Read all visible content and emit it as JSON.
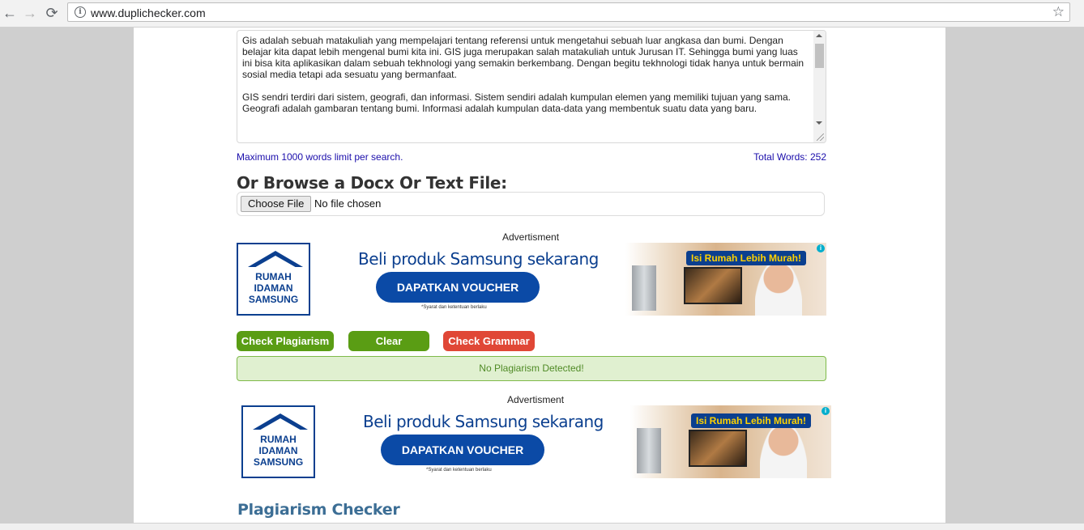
{
  "browser": {
    "url": "www.duplichecker.com",
    "back_icon": "←",
    "forward_icon": "→",
    "reload_icon": "⟳",
    "info_icon": "i",
    "star_icon": "☆"
  },
  "editor": {
    "text": "Gis adalah sebuah matakuliah yang mempelajari tentang referensi untuk mengetahui sebuah luar angkasa dan bumi. Dengan belajar kita dapat lebih mengenal bumi kita ini. GIS juga merupakan salah matakuliah untuk Jurusan IT. Sehingga bumi yang luas ini bisa kita aplikasikan dalam sebuah tekhnologi yang semakin berkembang. Dengan begitu tekhnologi tidak hanya untuk bermain sosial media tetapi ada sesuatu yang bermanfaat.\n\nGIS sendri terdiri dari sistem, geografi, dan informasi. Sistem sendiri adalah kumpulan elemen yang memiliki tujuan yang sama. Geografi adalah gambaran tentang bumi. Informasi adalah kumpulan data-data yang membentuk suatu data yang baru.",
    "limit_text": "Maximum 1000 words limit per search.",
    "total_words": "Total Words: 252"
  },
  "upload": {
    "heading": "Or Browse a Docx Or Text File:",
    "button_label": "Choose File",
    "status": "No file chosen"
  },
  "ads": [
    {
      "label": "Advertisment",
      "logo_text": "RUMAH\nIDAMAN\nSAMSUNG",
      "headline": "Beli produk Samsung sekarang",
      "cta": "DAPATKAN VOUCHER",
      "fine_print": "*Syarat dan ketentuan berlaku",
      "tag": "Isi Rumah Lebih Murah!",
      "info_icon": "i"
    },
    {
      "label": "Advertisment",
      "logo_text": "RUMAH\nIDAMAN\nSAMSUNG",
      "headline": "Beli produk Samsung sekarang",
      "cta": "DAPATKAN VOUCHER",
      "fine_print": "*Syarat dan ketentuan berlaku",
      "tag": "Isi Rumah Lebih Murah!",
      "info_icon": "i"
    }
  ],
  "actions": {
    "check_plagiarism": "Check Plagiarism",
    "clear": "Clear",
    "check_grammar": "Check Grammar"
  },
  "result": {
    "message": "No Plagiarism Detected!"
  },
  "footer": {
    "heading": "Plagiarism Checker"
  },
  "colors": {
    "green_button": "#5a9d14",
    "red_button": "#e04736",
    "link_blue": "#1a0dab",
    "samsung_blue": "#0b3f8f",
    "success_bg": "#e0f0d0"
  }
}
